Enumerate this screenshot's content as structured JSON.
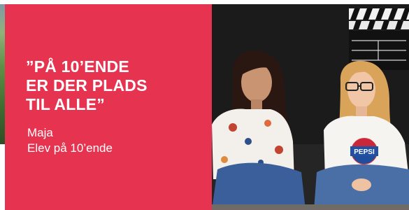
{
  "slide": {
    "quote": "”PÅ 10’ENDE\nER DER PLADS\nTIL ALLE”",
    "person_name": "Maja",
    "person_role": "Elev på 10’ende",
    "accent_color": "#e63450"
  },
  "photo": {
    "logo_text": "PEPSI"
  }
}
